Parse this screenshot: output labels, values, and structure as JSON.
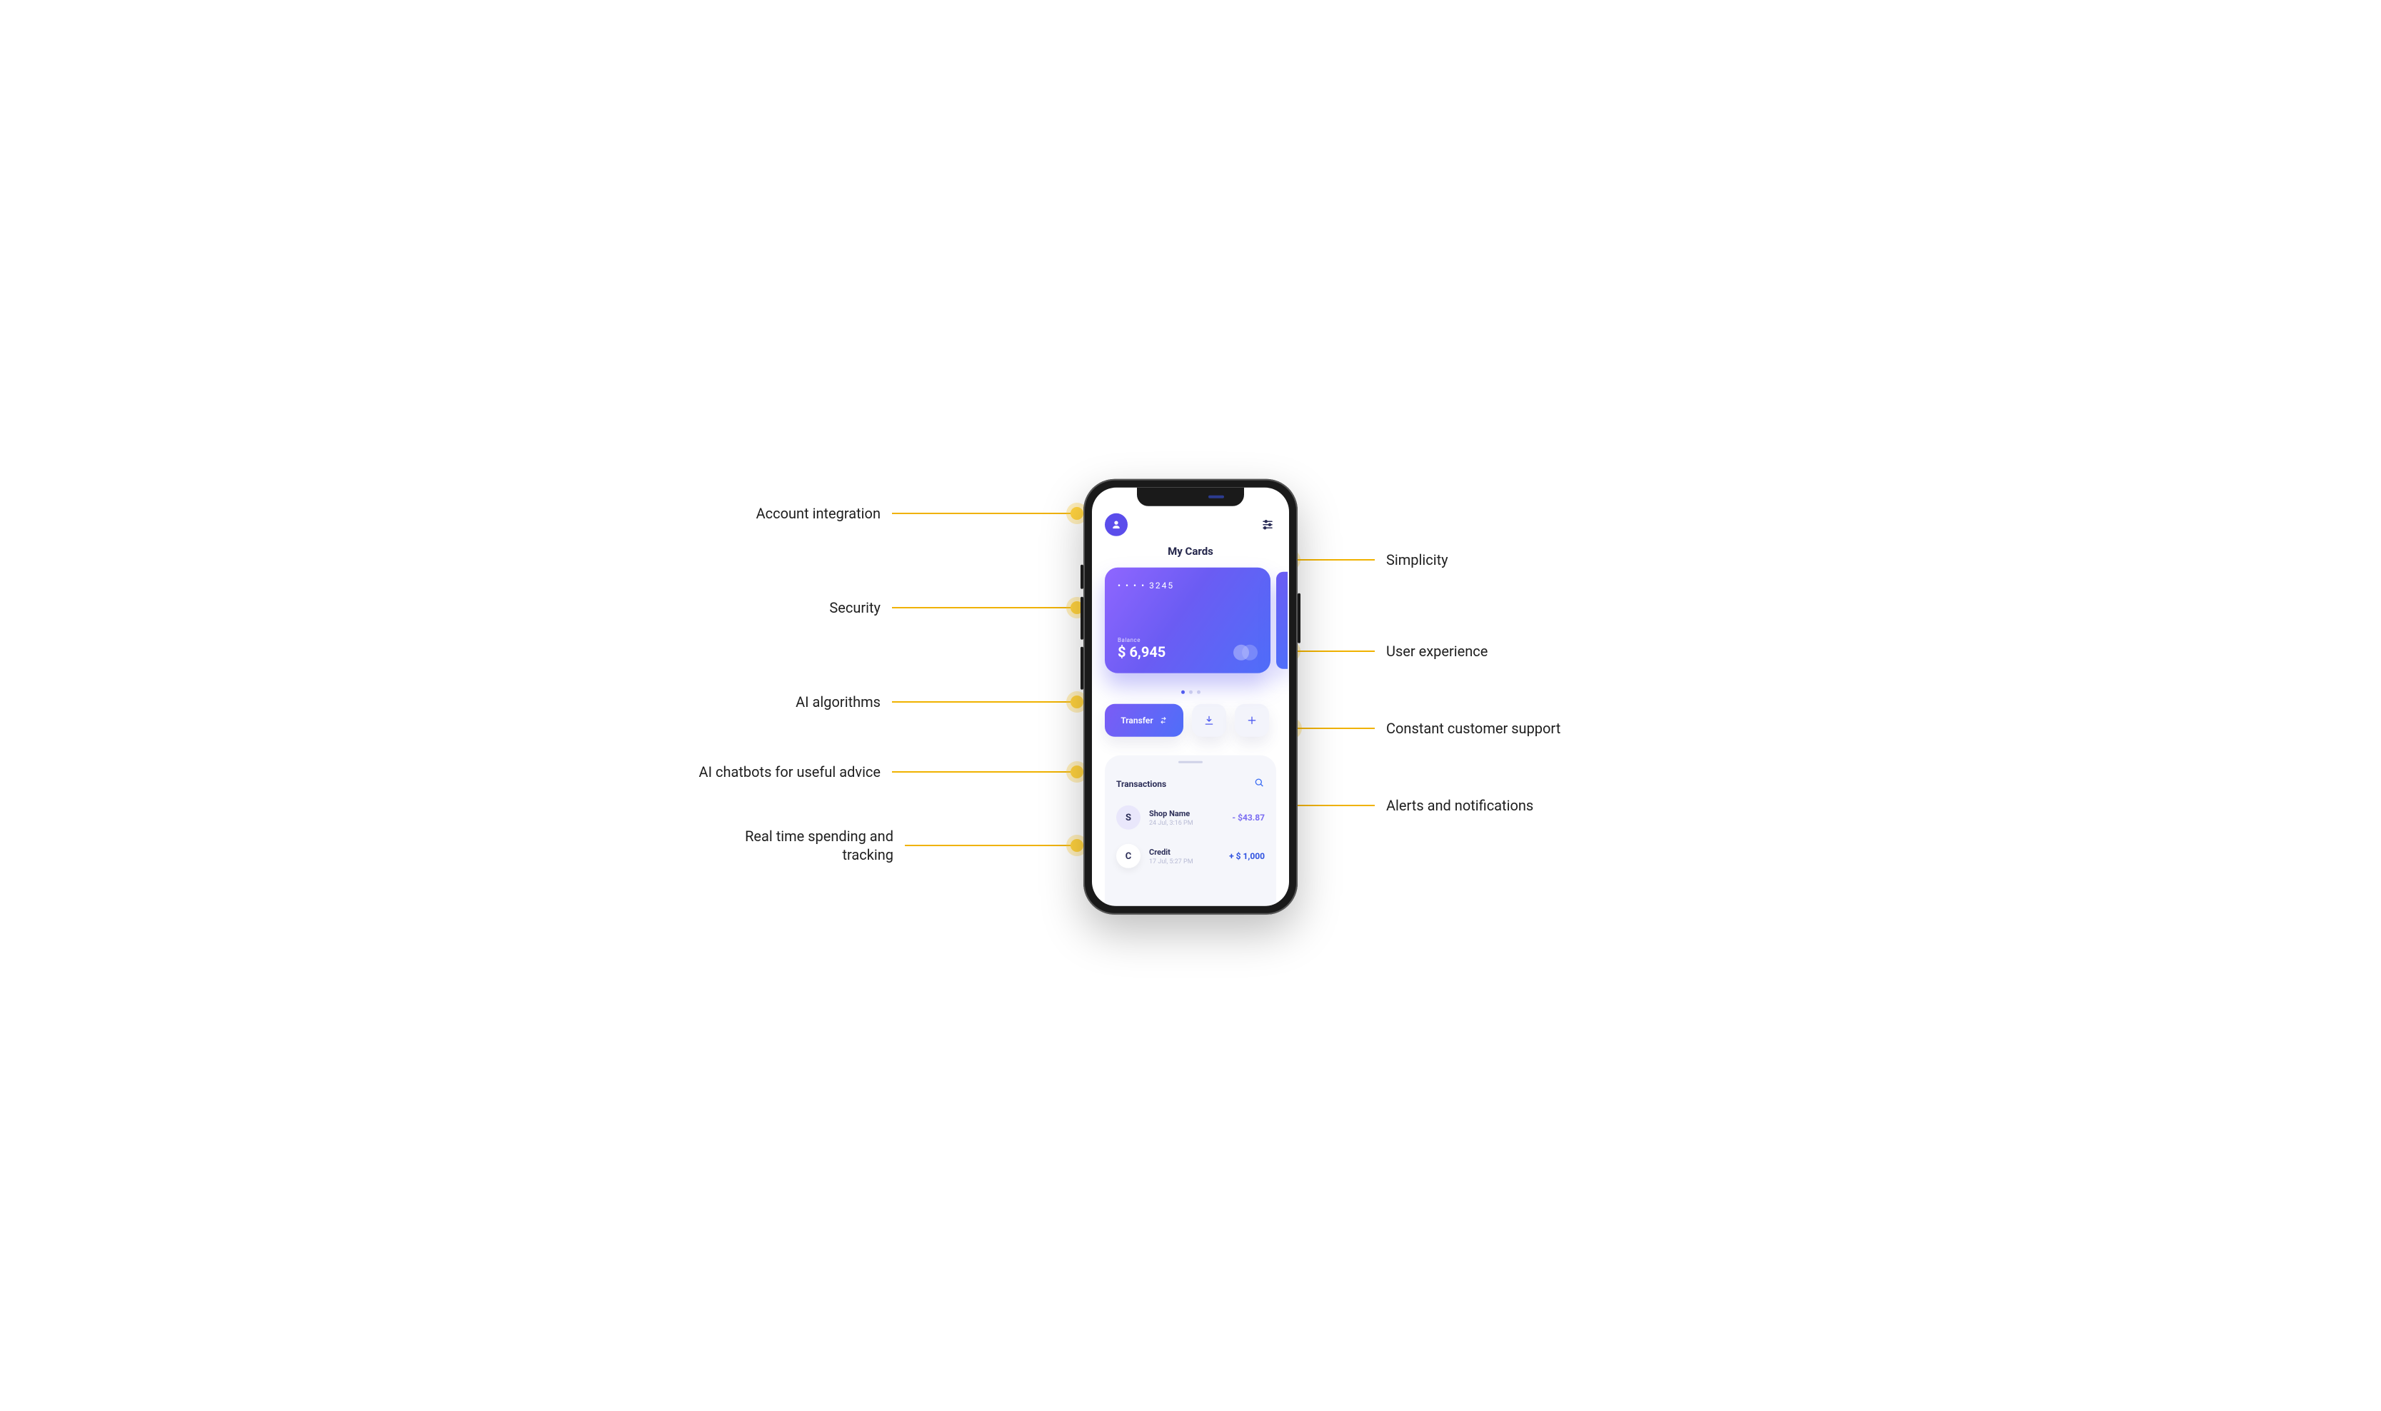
{
  "app": {
    "title": "My Cards",
    "card": {
      "masked_number": "• • • • 3245",
      "balance_label": "Balance",
      "balance_value": "$ 6,945"
    },
    "actions": {
      "transfer": "Transfer"
    },
    "transactions": {
      "title": "Transactions",
      "items": [
        {
          "initial": "S",
          "name": "Shop Name",
          "date": "24 Jul, 3:16 PM",
          "amount": "- $43.87",
          "sign": "neg"
        },
        {
          "initial": "C",
          "name": "Credit",
          "date": "17 Jul, 5:27 PM",
          "amount": "+ $ 1,000",
          "sign": "pos"
        }
      ]
    }
  },
  "callouts": {
    "left": [
      "Account integration",
      "Security",
      "AI algorithms",
      "AI chatbots for useful advice",
      "Real time spending and tracking"
    ],
    "right": [
      "Simplicity",
      "User experience",
      "Constant customer support",
      "Alerts and notifications"
    ]
  }
}
